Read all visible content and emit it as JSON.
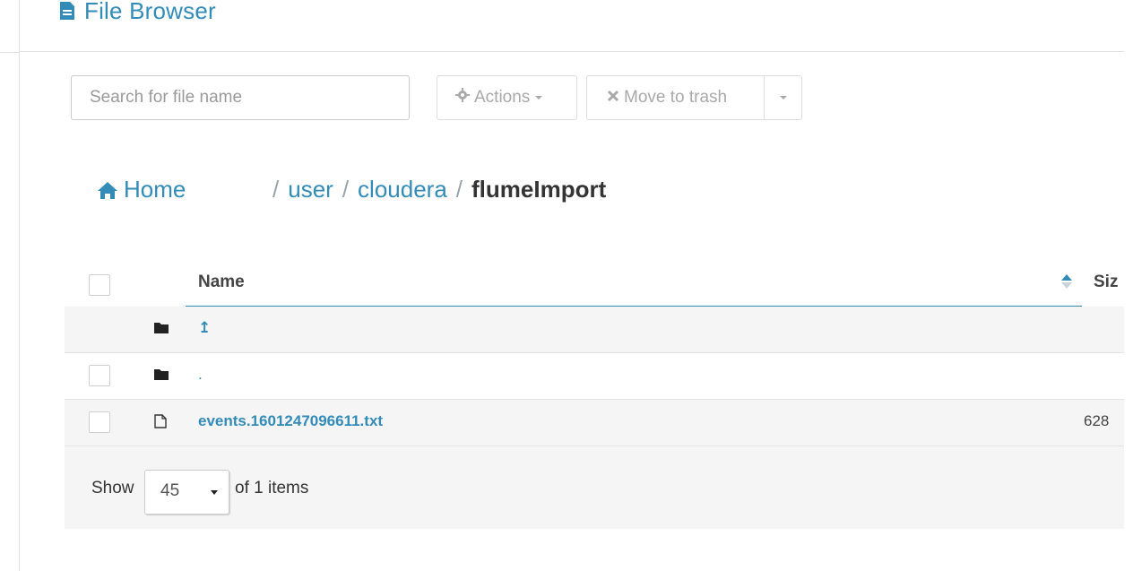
{
  "header": {
    "title": "File Browser",
    "icon": "file-icon"
  },
  "toolbar": {
    "search_placeholder": "Search for file name",
    "actions_label": "Actions",
    "actions_icon": "gear-icon",
    "trash_label": "Move to trash",
    "trash_icon": "x-icon"
  },
  "breadcrumb": {
    "home_label": "Home",
    "separator": "/",
    "path": [
      "user",
      "cloudera"
    ],
    "current": "flumeImport"
  },
  "table": {
    "columns": {
      "name": "Name",
      "size": "Siz"
    },
    "rows": [
      {
        "name": "↥",
        "type": "folder",
        "size": ""
      },
      {
        "name": ".",
        "type": "folder",
        "size": ""
      },
      {
        "name": "events.1601247096611.txt",
        "type": "file",
        "size": "628"
      }
    ]
  },
  "pagination": {
    "show_label": "Show",
    "page_size": "45",
    "of_label": "of 1 items"
  },
  "colors": {
    "accent": "#338bb8",
    "muted": "#a9a9a9",
    "row_alt": "#f5f5f5"
  }
}
